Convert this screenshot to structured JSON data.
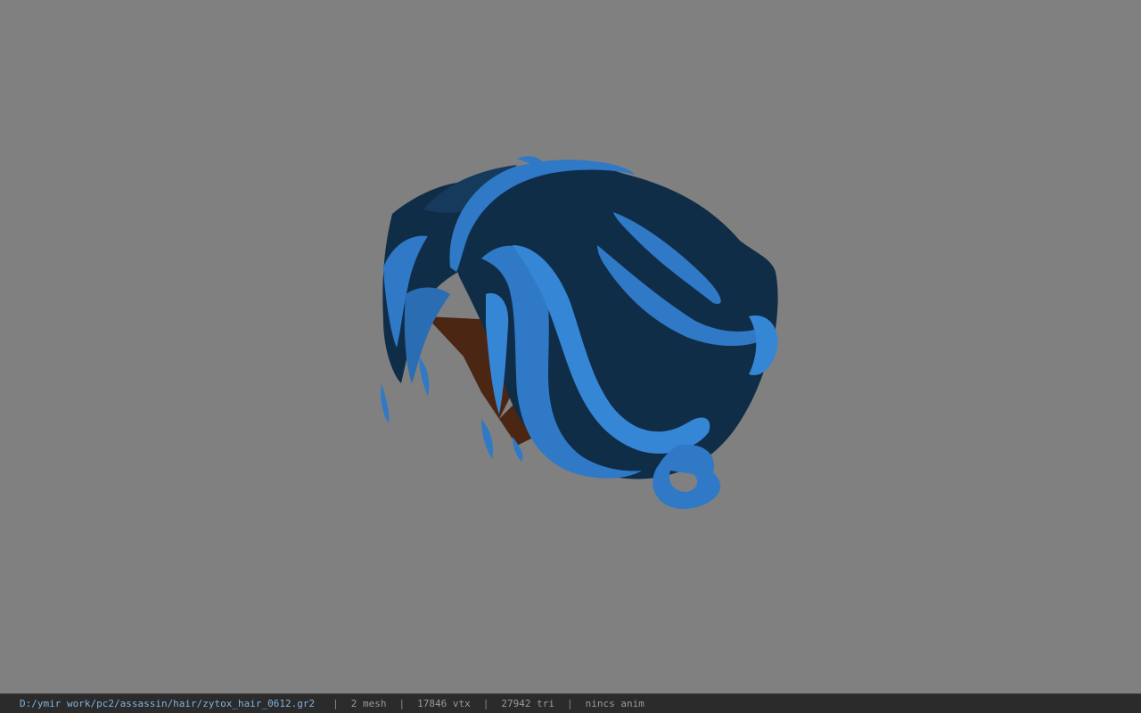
{
  "viewer": {
    "background_color": "#808080",
    "model_colors": {
      "hair_dark": "#102d48",
      "hair_light": "#2f79c6",
      "scalp": "#4a2613"
    }
  },
  "status_bar": {
    "file_path": "D:/ymir work/pc2/assassin/hair/zytox_hair_0612.gr2",
    "separator": "|",
    "mesh_count": "2 mesh",
    "vertex_count": "17846 vtx",
    "triangle_count": "27942 tri",
    "anim_status": "nincs anim"
  }
}
